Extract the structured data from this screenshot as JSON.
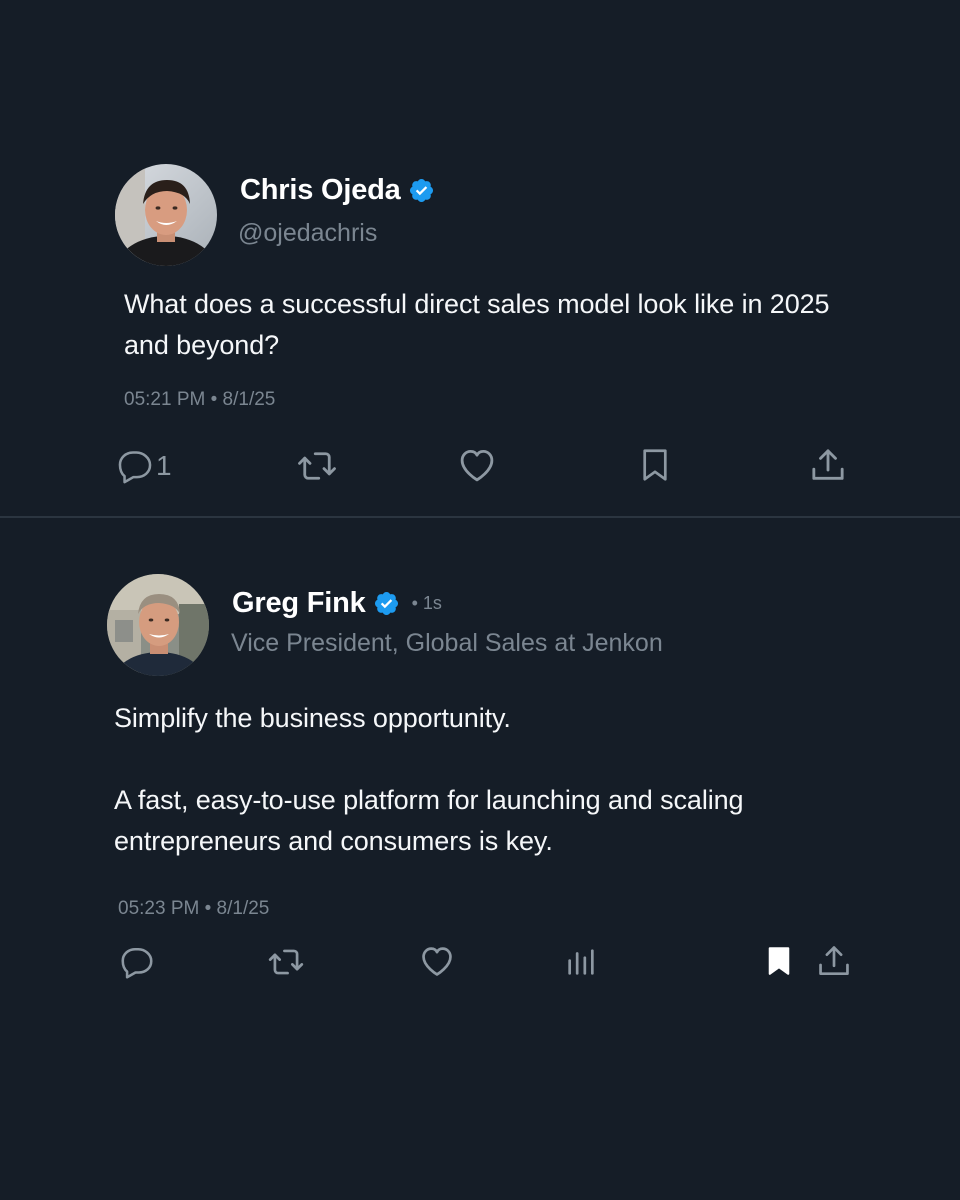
{
  "tweets": [
    {
      "author_name": "Chris Ojeda",
      "handle": "@ojedachris",
      "text_paragraphs": [
        "What does a successful direct sales model look like in 2025 and beyond?"
      ],
      "timestamp": "05:21 PM • 8/1/25",
      "reply_count": "1"
    },
    {
      "author_name": "Greg Fink",
      "time_ago": "• 1s",
      "subtitle": "Vice President, Global Sales at Jenkon",
      "text_paragraphs": [
        "Simplify the business opportunity.",
        "A fast, easy-to-use platform for launching and scaling entrepreneurs and consumers is key."
      ],
      "timestamp": "05:23 PM • 8/1/25"
    }
  ],
  "icons": {
    "verified": "verified-badge-icon",
    "reply": "reply-icon",
    "retweet": "retweet-icon",
    "like": "heart-icon",
    "bookmark": "bookmark-icon",
    "views": "views-icon",
    "share": "share-icon"
  },
  "colors": {
    "background": "#151d27",
    "verified_blue": "#1d9bf0",
    "muted_text": "#7b8691",
    "icon_gray": "#8d98a2",
    "divider": "#2b3540"
  }
}
